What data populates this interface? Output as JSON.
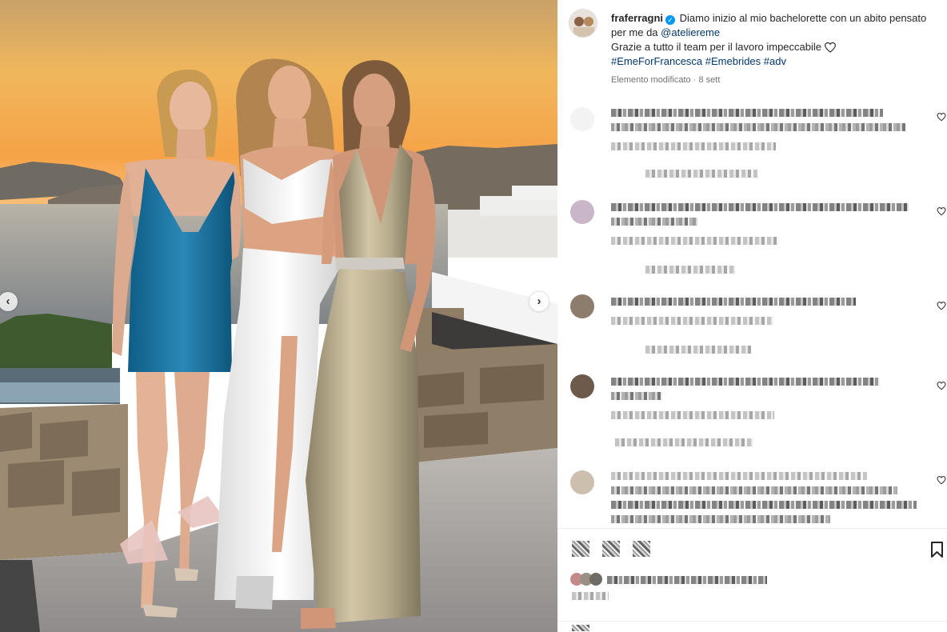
{
  "post": {
    "username": "fraferragni",
    "verified_mark": "✓",
    "caption_line1": "Diamo inizio al mio bachelorette con un abito pensato per me da",
    "caption_mention": "@ateliereme",
    "caption_line2": "Grazie a tutto il team per il lavoro impeccabile",
    "hashtags": [
      "#EmeForFrancesca",
      "#Emebrides",
      "#adv"
    ],
    "meta_label": "Elemento modificato",
    "meta_separator": "·",
    "meta_date": "8 sett"
  },
  "carousel": {
    "prev_label": "‹",
    "next_label": "›"
  },
  "icons": {
    "verified": "verified-badge-icon",
    "caption_heart": "heart-outline-icon",
    "comment_like": "heart-outline-icon",
    "save": "bookmark-icon",
    "carousel_prev": "chevron-left-icon",
    "carousel_next": "chevron-right-icon"
  },
  "colors": {
    "link": "#00376b",
    "verified": "#0095f6",
    "meta": "#737373",
    "text": "#262626"
  }
}
